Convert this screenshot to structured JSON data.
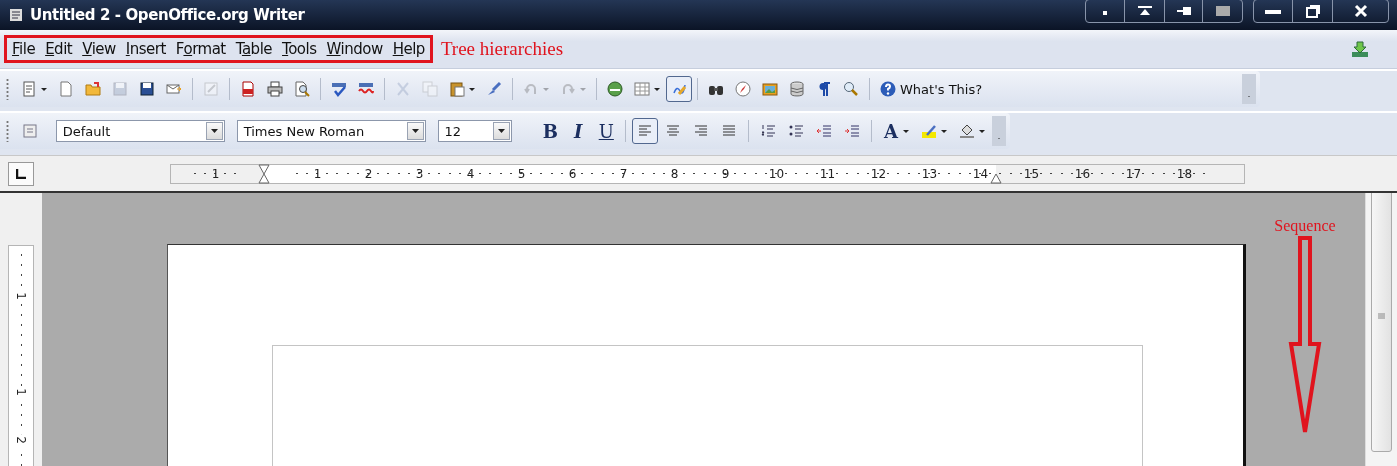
{
  "window": {
    "title": "Untitled 2 - OpenOffice.org Writer"
  },
  "menu": {
    "items": [
      {
        "key": "F",
        "rest": "ile"
      },
      {
        "key": "E",
        "rest": "dit"
      },
      {
        "key": "V",
        "rest": "iew"
      },
      {
        "key": "I",
        "rest": "nsert"
      },
      {
        "lead": "F",
        "key": "o",
        "rest": "rmat"
      },
      {
        "lead": "T",
        "key": "a",
        "rest": "ble"
      },
      {
        "key": "T",
        "rest": "ools"
      },
      {
        "key": "W",
        "rest": "indow"
      },
      {
        "key": "H",
        "rest": "elp"
      }
    ],
    "annotation": "Tree hierarchies"
  },
  "standard_toolbar": {
    "items": [
      {
        "kind": "templates",
        "dropdown": true,
        "disabled": false,
        "selected": false
      },
      {
        "kind": "new",
        "dropdown": false,
        "disabled": false,
        "selected": false
      },
      {
        "kind": "open",
        "dropdown": false,
        "disabled": false,
        "selected": false
      },
      {
        "kind": "save",
        "dropdown": false,
        "disabled": true,
        "selected": false
      },
      {
        "kind": "saveas",
        "dropdown": false,
        "disabled": false,
        "selected": false
      },
      {
        "kind": "email",
        "dropdown": false,
        "disabled": false,
        "selected": false
      },
      {
        "kind": "sep"
      },
      {
        "kind": "edit",
        "dropdown": false,
        "disabled": true,
        "selected": false
      },
      {
        "kind": "sep"
      },
      {
        "kind": "pdf",
        "dropdown": false,
        "disabled": false,
        "selected": false
      },
      {
        "kind": "print",
        "dropdown": false,
        "disabled": false,
        "selected": false
      },
      {
        "kind": "preview",
        "dropdown": false,
        "disabled": false,
        "selected": false
      },
      {
        "kind": "sep"
      },
      {
        "kind": "spelling",
        "dropdown": false,
        "disabled": false,
        "selected": false
      },
      {
        "kind": "autospell",
        "dropdown": false,
        "disabled": false,
        "selected": false
      },
      {
        "kind": "sep"
      },
      {
        "kind": "cut",
        "dropdown": false,
        "disabled": true,
        "selected": false
      },
      {
        "kind": "copy",
        "dropdown": false,
        "disabled": true,
        "selected": false
      },
      {
        "kind": "paste",
        "dropdown": true,
        "disabled": false,
        "selected": false
      },
      {
        "kind": "brush",
        "dropdown": false,
        "disabled": false,
        "selected": false
      },
      {
        "kind": "sep"
      },
      {
        "kind": "undo",
        "dropdown": true,
        "disabled": true,
        "selected": false
      },
      {
        "kind": "redo",
        "dropdown": true,
        "disabled": true,
        "selected": false
      },
      {
        "kind": "sep"
      },
      {
        "kind": "hyperlink",
        "dropdown": false,
        "disabled": false,
        "selected": false
      },
      {
        "kind": "table",
        "dropdown": true,
        "disabled": false,
        "selected": false
      },
      {
        "kind": "draw",
        "dropdown": false,
        "disabled": false,
        "selected": true
      },
      {
        "kind": "sep"
      },
      {
        "kind": "find",
        "dropdown": false,
        "disabled": false,
        "selected": false
      },
      {
        "kind": "navigator",
        "dropdown": false,
        "disabled": false,
        "selected": false
      },
      {
        "kind": "gallery",
        "dropdown": false,
        "disabled": false,
        "selected": false
      },
      {
        "kind": "database",
        "dropdown": false,
        "disabled": false,
        "selected": false
      },
      {
        "kind": "pilcrow",
        "dropdown": false,
        "disabled": false,
        "selected": false
      },
      {
        "kind": "zoom",
        "dropdown": false,
        "disabled": false,
        "selected": false
      },
      {
        "kind": "sep"
      },
      {
        "kind": "help",
        "label": "What's This?",
        "dropdown": false,
        "disabled": false,
        "selected": false
      }
    ]
  },
  "formatting_toolbar": {
    "style": "Default",
    "font": "Times New Roman",
    "size": "12",
    "items": [
      {
        "kind": "bold",
        "label": "B",
        "dropdown": false,
        "selected": false
      },
      {
        "kind": "italic",
        "label": "I",
        "dropdown": false,
        "selected": false
      },
      {
        "kind": "underline",
        "label": "U",
        "dropdown": false,
        "selected": false
      },
      {
        "kind": "sep"
      },
      {
        "kind": "alignleft",
        "dropdown": false,
        "selected": true
      },
      {
        "kind": "center",
        "dropdown": false,
        "selected": false
      },
      {
        "kind": "alignright",
        "dropdown": false,
        "selected": false
      },
      {
        "kind": "justify",
        "dropdown": false,
        "selected": false
      },
      {
        "kind": "sep"
      },
      {
        "kind": "numbering",
        "dropdown": false,
        "selected": false
      },
      {
        "kind": "bullets",
        "dropdown": false,
        "selected": false
      },
      {
        "kind": "outdent",
        "dropdown": false,
        "selected": false
      },
      {
        "kind": "indent",
        "dropdown": false,
        "selected": false
      },
      {
        "kind": "sep"
      },
      {
        "kind": "fontcolor",
        "label": "A",
        "dropdown": true,
        "selected": false
      },
      {
        "kind": "highlight",
        "dropdown": true,
        "selected": false
      },
      {
        "kind": "background",
        "dropdown": true,
        "selected": false
      }
    ]
  },
  "ruler": {
    "labels": [
      "1",
      "1",
      "2",
      "3",
      "4",
      "5",
      "6",
      "7",
      "8",
      "9",
      "10",
      "11",
      "12",
      "13",
      "14",
      "15",
      "16",
      "17",
      "18"
    ]
  },
  "vertical_ruler": {
    "labels": [
      "1",
      "1",
      "2"
    ]
  },
  "document": {
    "annotation": "Sequence"
  }
}
